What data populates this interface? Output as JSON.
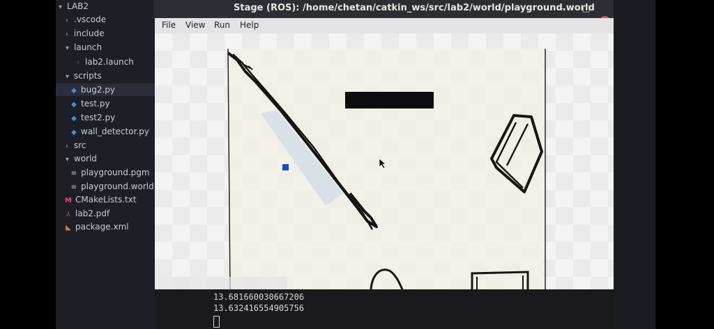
{
  "explorer": {
    "items": [
      {
        "label": "LAB2",
        "kind": "folder-open",
        "depth": 0
      },
      {
        "label": ".vscode",
        "kind": "folder",
        "depth": 1
      },
      {
        "label": "include",
        "kind": "folder",
        "depth": 1
      },
      {
        "label": "launch",
        "kind": "folder-open",
        "depth": 1
      },
      {
        "label": "lab2.launch",
        "kind": "launch-file",
        "depth": 2
      },
      {
        "label": "scripts",
        "kind": "folder-open",
        "depth": 1
      },
      {
        "label": "bug2.py",
        "kind": "python",
        "depth": 2,
        "selected": true
      },
      {
        "label": "test.py",
        "kind": "python",
        "depth": 2
      },
      {
        "label": "test2.py",
        "kind": "python",
        "depth": 2
      },
      {
        "label": "wall_detector.py",
        "kind": "python",
        "depth": 2
      },
      {
        "label": "src",
        "kind": "folder",
        "depth": 1
      },
      {
        "label": "world",
        "kind": "folder-open",
        "depth": 1
      },
      {
        "label": "playground.pgm",
        "kind": "text-file",
        "depth": 2
      },
      {
        "label": "playground.world",
        "kind": "text-file",
        "depth": 2
      },
      {
        "label": "CMakeLists.txt",
        "kind": "cmake",
        "depth": 1
      },
      {
        "label": "lab2.pdf",
        "kind": "pdf",
        "depth": 1
      },
      {
        "label": "package.xml",
        "kind": "xml",
        "depth": 1
      }
    ]
  },
  "stage": {
    "title": "Stage (ROS): /home/chetan/catkin_ws/src/lab2/world/playground.world",
    "menu": [
      "File",
      "View",
      "Run",
      "Help"
    ],
    "robot_color": "#1a47d6"
  },
  "terminal": {
    "lines": [
      "13.681660030667206",
      "13.632416554905756"
    ]
  },
  "colors": {
    "window_chrome": "#2d2e33",
    "editor_sidebar": "#1e1f26",
    "map_background": "#f1f0e8",
    "obstacle": "#111111",
    "close_button": "#e2543a"
  }
}
